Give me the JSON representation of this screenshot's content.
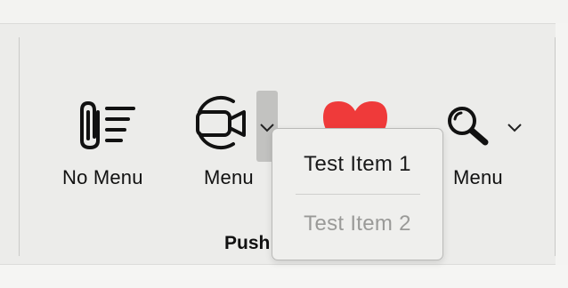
{
  "toolbar": {
    "buttons": [
      {
        "label": "No Menu",
        "icon": "paperclip-list-icon"
      },
      {
        "label": "Menu",
        "icon": "video-camera-icon"
      },
      {
        "label": "",
        "icon": "heart-icon"
      },
      {
        "label": "Menu",
        "icon": "magnifier-icon"
      }
    ],
    "group_label": "Push"
  },
  "popup_menu": {
    "items": [
      {
        "label": "Test Item 1",
        "enabled": true
      },
      {
        "label": "Test Item 2",
        "enabled": false
      }
    ]
  },
  "colors": {
    "heart": "#ef3a3a",
    "panel": "#ececea",
    "disabled_text": "#9a9a98"
  }
}
